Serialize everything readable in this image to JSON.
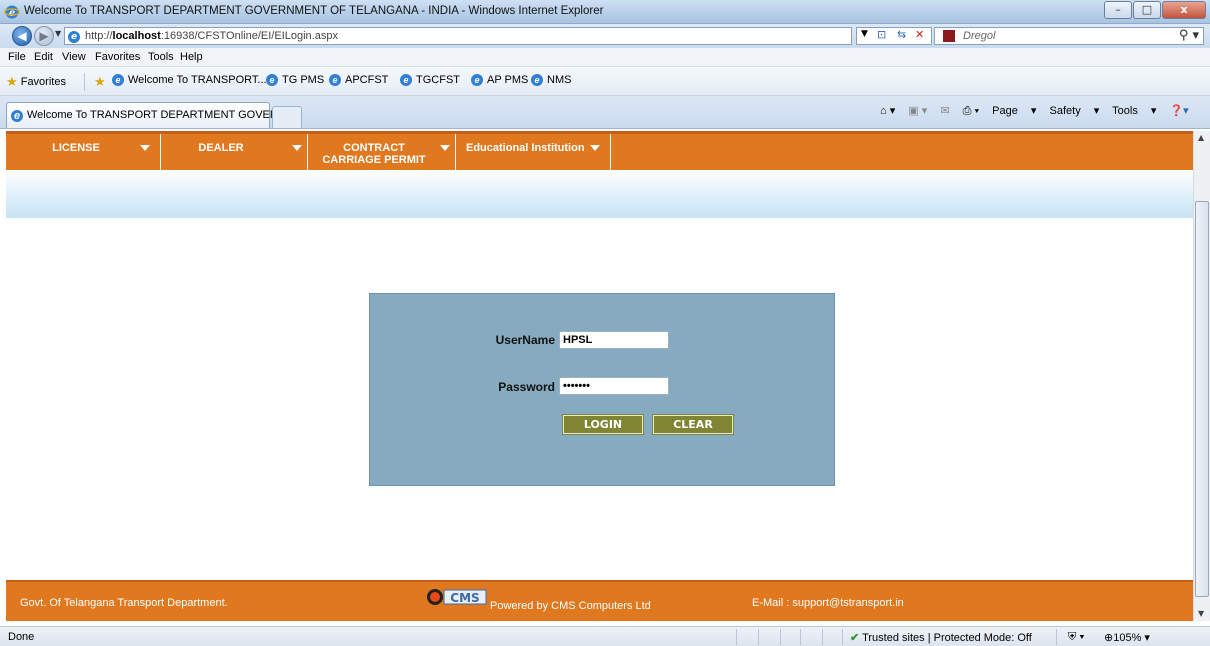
{
  "window": {
    "title": "Welcome To TRANSPORT DEPARTMENT GOVERNMENT OF TELANGANA - INDIA - Windows Internet Explorer",
    "minimize": "–",
    "maximize": "□",
    "close": "x"
  },
  "address": {
    "url_prefix": "http://",
    "url_host": "localhost",
    "url_rest": ":16938/CFSTOnline/EI/EILogin.aspx",
    "search_provider": "Dregol"
  },
  "menu": [
    "File",
    "Edit",
    "View",
    "Favorites",
    "Tools",
    "Help"
  ],
  "favorites": {
    "label": "Favorites",
    "items": [
      "Welcome To TRANSPORT...",
      "TG PMS",
      "APCFST",
      "TGCFST",
      "AP PMS",
      "NMS"
    ]
  },
  "tab": {
    "title": "Welcome To TRANSPORT DEPARTMENT GOVER..."
  },
  "commandbar": {
    "page": "Page",
    "safety": "Safety",
    "tools": "Tools"
  },
  "nav": {
    "items": [
      {
        "label": "LICENSE"
      },
      {
        "label": "DEALER"
      },
      {
        "label": "CONTRACT CARRIAGE PERMIT"
      },
      {
        "label": "Educational Institution"
      }
    ]
  },
  "login": {
    "username_label": "UserName",
    "username_value": "HPSL",
    "password_label": "Password",
    "password_value": "•••••••",
    "login_button": "LOGIN",
    "clear_button": "CLEAR"
  },
  "footer": {
    "dept": "Govt. Of Telangana Transport Department.",
    "powered": "Powered by CMS Computers Ltd",
    "email": "E-Mail : support@tstransport.in",
    "logo_text": "CMS"
  },
  "status": {
    "left": "Done",
    "zone": "Trusted sites | Protected Mode: Off",
    "zoom": "105%"
  },
  "colors": {
    "nav_orange": "#e07820",
    "login_panel": "#86aac0",
    "button_olive": "#7f8533"
  }
}
